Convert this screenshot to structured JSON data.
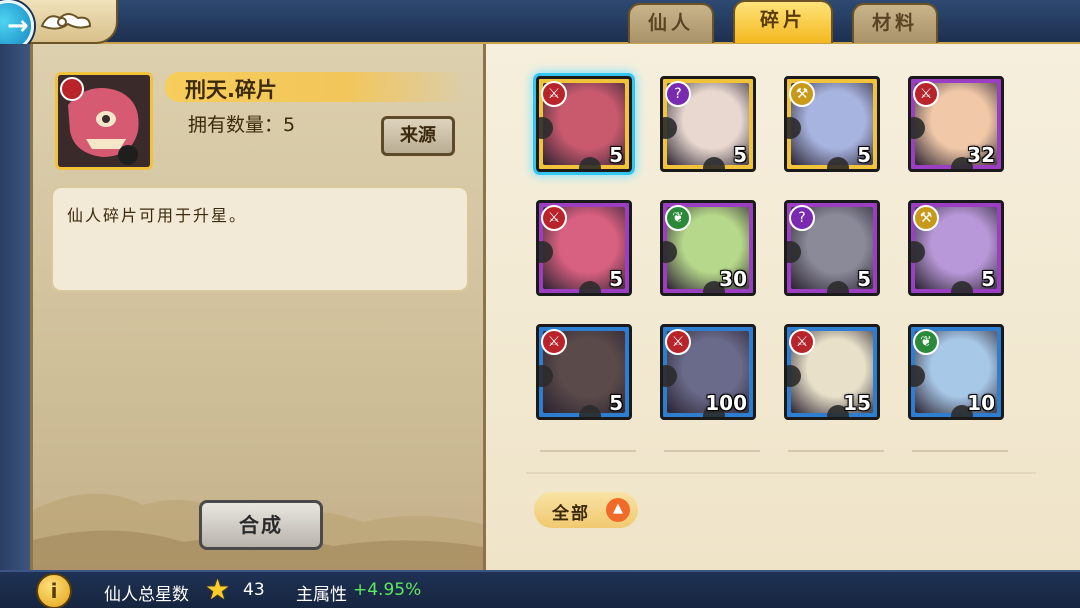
{
  "tabs": [
    {
      "label": "仙人",
      "active": false
    },
    {
      "label": "碎片",
      "active": true
    },
    {
      "label": "材料",
      "active": false
    }
  ],
  "detail": {
    "name": "刑天.碎片",
    "owned": "拥有数量：5",
    "source_btn": "来源",
    "description": "仙人碎片可用于升星。",
    "compose_btn": "合成"
  },
  "filter": {
    "label": "全部",
    "icon": "chevron-up-icon"
  },
  "grid": [
    {
      "frame": "gold",
      "element": "sword",
      "count": "5",
      "selected": true,
      "tone": "#c95a6e"
    },
    {
      "frame": "gold",
      "element": "hook",
      "count": "5",
      "selected": false,
      "tone": "#e8d8d0"
    },
    {
      "frame": "gold",
      "element": "axe",
      "count": "5",
      "selected": false,
      "tone": "#a8b4e0"
    },
    {
      "frame": "purple",
      "element": "sword",
      "count": "32",
      "selected": false,
      "tone": "#f2c9a8"
    },
    {
      "frame": "purple",
      "element": "sword",
      "count": "5",
      "selected": false,
      "tone": "#d86080"
    },
    {
      "frame": "purple",
      "element": "leaf",
      "count": "30",
      "selected": false,
      "tone": "#b6d88a"
    },
    {
      "frame": "purple",
      "element": "hook",
      "count": "5",
      "selected": false,
      "tone": "#8a8a98"
    },
    {
      "frame": "purple",
      "element": "axe",
      "count": "5",
      "selected": false,
      "tone": "#b898d8"
    },
    {
      "frame": "blue",
      "element": "sword",
      "count": "5",
      "selected": false,
      "tone": "#5a4a4a"
    },
    {
      "frame": "blue",
      "element": "sword",
      "count": "100",
      "selected": false,
      "tone": "#6a6a8a"
    },
    {
      "frame": "blue",
      "element": "sword",
      "count": "15",
      "selected": false,
      "tone": "#e8e0c8"
    },
    {
      "frame": "blue",
      "element": "leaf",
      "count": "10",
      "selected": false,
      "tone": "#a8c8e8"
    }
  ],
  "element_colors": {
    "sword": "#b8242a",
    "hook": "#7a2ab0",
    "axe": "#c99a1a",
    "leaf": "#2a8a3a"
  },
  "bottom": {
    "total_stars_label": "仙人总星数",
    "total_stars_value": "43",
    "main_attr_label": "主属性",
    "main_attr_value": "+4.95%"
  }
}
